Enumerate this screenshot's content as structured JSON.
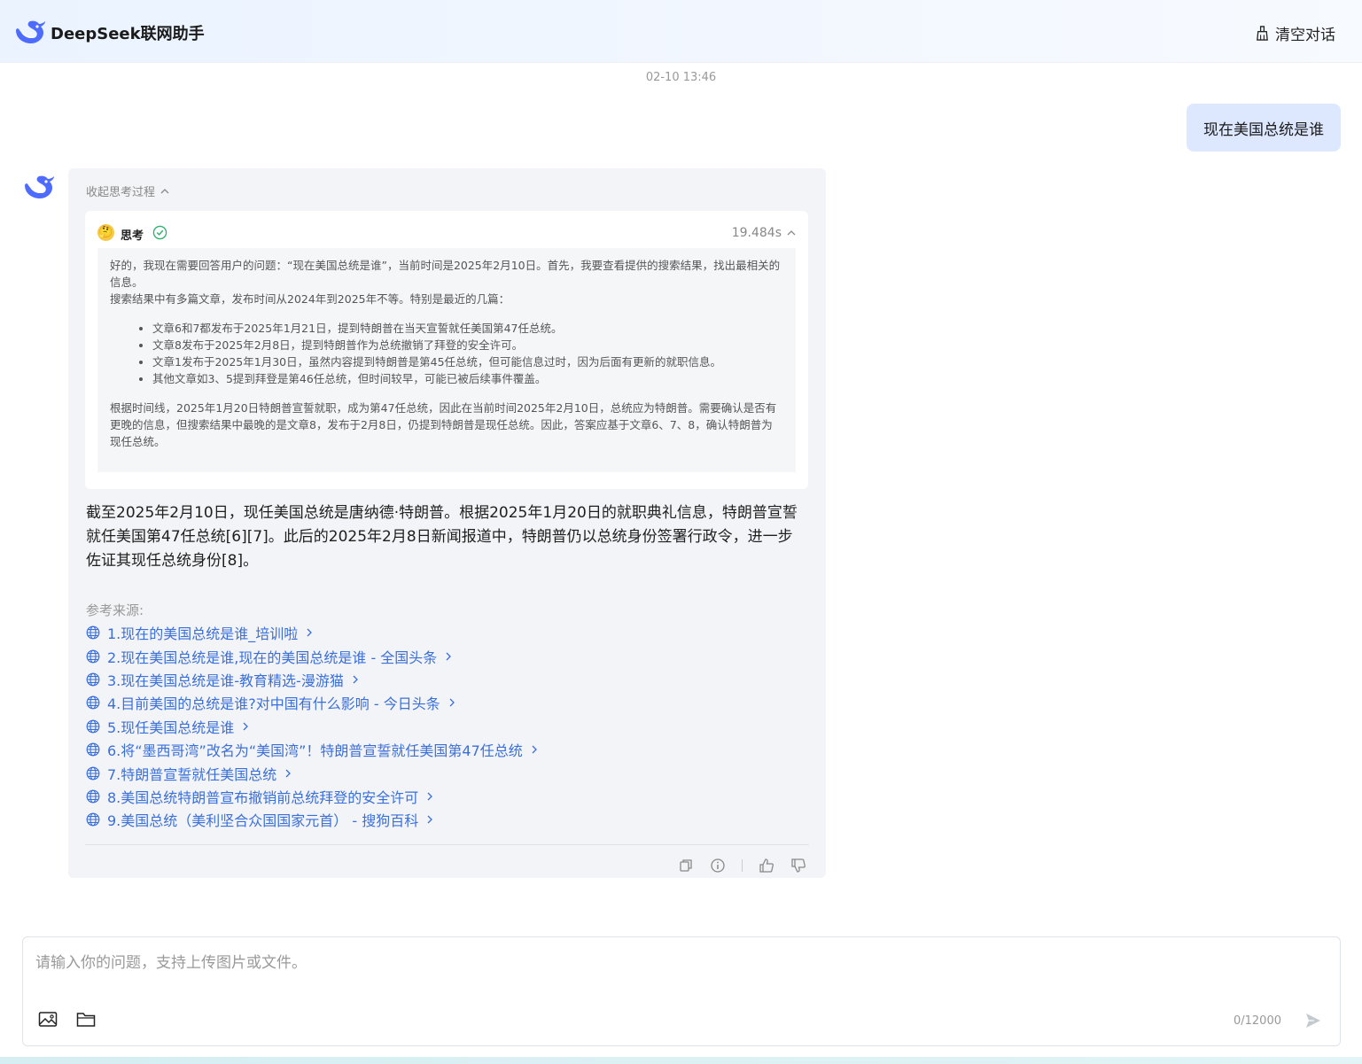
{
  "header": {
    "title": "DeepSeek联网助手",
    "clear_label": "清空对话"
  },
  "chat": {
    "timestamp": "02-10 13:46",
    "user_message": "现在美国总统是谁"
  },
  "answer": {
    "collapse_label": "收起思考过程",
    "think": {
      "emoji": "🤔",
      "label": "思考",
      "duration": "19.484s",
      "para1": "好的，我现在需要回答用户的问题：“现在美国总统是谁”，当前时间是2025年2月10日。首先，我要查看提供的搜索结果，找出最相关的信息。",
      "para2": "搜索结果中有多篇文章，发布时间从2024年到2025年不等。特别是最近的几篇：",
      "bullets": [
        "文章6和7都发布于2025年1月21日，提到特朗普在当天宣誓就任美国第47任总统。",
        "文章8发布于2025年2月8日，提到特朗普作为总统撤销了拜登的安全许可。",
        "文章1发布于2025年1月30日，虽然内容提到特朗普是第45任总统，但可能信息过时，因为后面有更新的就职信息。",
        "其他文章如3、5提到拜登是第46任总统，但时间较早，可能已被后续事件覆盖。"
      ],
      "para3": "根据时间线，2025年1月20日特朗普宣誓就职，成为第47任总统，因此在当前时间2025年2月10日，总统应为特朗普。需要确认是否有更晚的信息，但搜索结果中最晚的是文章8，发布于2月8日，仍提到特朗普是现任总统。因此，答案应基于文章6、7、8，确认特朗普为现任总统。"
    },
    "text": "截至2025年2月10日，现任美国总统是唐纳德·特朗普。根据2025年1月20日的就职典礼信息，特朗普宣誓就任美国第47任总统[6][7]。此后的2025年2月8日新闻报道中，特朗普仍以总统身份签署行政令，进一步佐证其现任总统身份[8]。",
    "sources_title": "参考来源:",
    "sources": [
      "1.现在的美国总统是谁_培训啦",
      "2.现在美国总统是谁,现在的美国总统是谁 - 全国头条",
      "3.现在美国总统是谁-教育精选-漫游猫",
      "4.目前美国的总统是谁?对中国有什么影响 - 今日头条",
      "5.现任美国总统是谁",
      "6.将“墨西哥湾”改名为“美国湾”！特朗普宣誓就任美国第47任总统",
      "7.特朗普宣誓就任美国总统",
      "8.美国总统特朗普宣布撤销前总统拜登的安全许可",
      "9.美国总统（美利坚合众国国家元首） - 搜狗百科"
    ]
  },
  "input": {
    "placeholder": "请输入你的问题，支持上传图片或文件。",
    "value": "",
    "char_count": "0/12000"
  },
  "colors": {
    "accent": "#3b6fd8",
    "user_bubble": "#dde8ff",
    "logo": "#4d6bfe"
  }
}
